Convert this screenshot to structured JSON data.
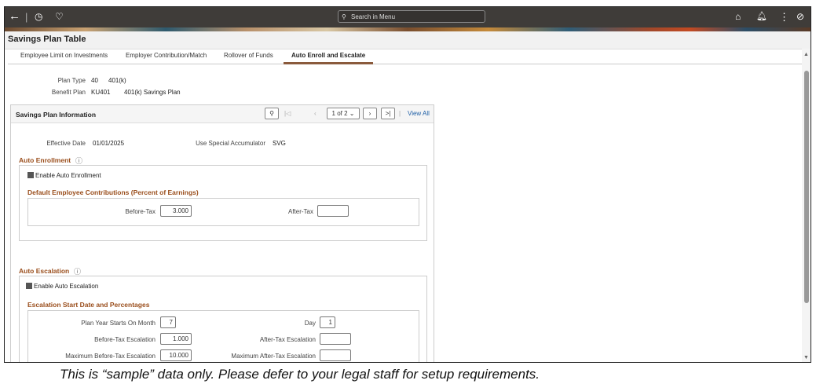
{
  "header": {
    "search_placeholder": "Search in Menu"
  },
  "page_title": "Savings Plan Table",
  "tabs": [
    {
      "label": "Employee Limit on Investments"
    },
    {
      "label": "Employer Contribution/Match"
    },
    {
      "label": "Rollover of Funds"
    },
    {
      "label": "Auto Enroll and Escalate",
      "active": true
    }
  ],
  "plan": {
    "plan_type_label": "Plan Type",
    "plan_type": "40",
    "plan_type_desc": "401(k)",
    "benefit_plan_label": "Benefit Plan",
    "benefit_plan": "KU401",
    "benefit_plan_desc": "401(k) Savings Plan"
  },
  "section": {
    "title": "Savings Plan Information",
    "page_indicator": "1 of 2",
    "view_all": "View All"
  },
  "effective_date_label": "Effective Date",
  "effective_date": "01/01/2025",
  "special_accum_label": "Use Special Accumulator",
  "special_accum": "SVG",
  "auto_enroll": {
    "title": "Auto Enrollment",
    "enable_label": "Enable Auto Enrollment",
    "enabled": true,
    "default_title": "Default Employee Contributions (Percent of Earnings)",
    "before_tax_label": "Before-Tax",
    "before_tax": "3.000",
    "after_tax_label": "After-Tax",
    "after_tax": ""
  },
  "auto_escalation": {
    "title": "Auto Escalation",
    "enable_label": "Enable Auto Escalation",
    "enabled": true,
    "start_title": "Escalation Start Date and Percentages",
    "month_label": "Plan Year Starts On Month",
    "month": "7",
    "day_label": "Day",
    "day": "1",
    "bt_esc_label": "Before-Tax Escalation",
    "bt_esc": "1.000",
    "at_esc_label": "After-Tax Escalation",
    "at_esc": "",
    "max_bt_label": "Maximum Before-Tax Escalation",
    "max_bt": "10.000",
    "max_at_label": "Maximum After-Tax Escalation",
    "max_at": ""
  },
  "caption": "This is “sample” data only. Please defer to your legal staff for setup requirements."
}
